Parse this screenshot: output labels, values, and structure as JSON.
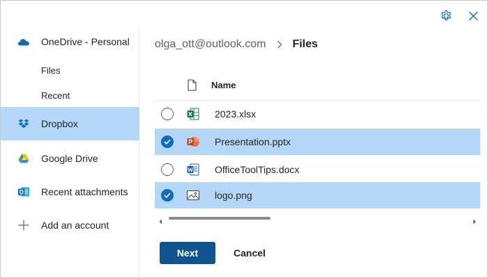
{
  "header": {
    "settings_icon": "gear-icon",
    "close_icon": "close-icon"
  },
  "sidebar": {
    "accounts": [
      {
        "label": "OneDrive - Personal",
        "icon": "onedrive-icon",
        "children": [
          {
            "label": "Files"
          },
          {
            "label": "Recent"
          }
        ]
      },
      {
        "label": "Dropbox",
        "icon": "dropbox-icon",
        "selected": true
      },
      {
        "label": "Google Drive",
        "icon": "google-drive-icon"
      },
      {
        "label": "Recent attachments",
        "icon": "outlook-icon"
      },
      {
        "label": "Add an account",
        "icon": "plus-icon"
      }
    ]
  },
  "breadcrumb": {
    "root": "olga_ott@outlook.com",
    "current": "Files"
  },
  "file_list": {
    "column_name": "Name",
    "files": [
      {
        "name": "2023.xlsx",
        "type": "excel",
        "selected": false
      },
      {
        "name": "Presentation.pptx",
        "type": "powerpoint",
        "selected": true
      },
      {
        "name": "OfficeToolTips.docx",
        "type": "word",
        "selected": false
      },
      {
        "name": "logo.png",
        "type": "image",
        "selected": true
      }
    ]
  },
  "actions": {
    "next": "Next",
    "cancel": "Cancel"
  },
  "colors": {
    "selection": "#b3d6f9",
    "primary_button": "#0f548c",
    "checkbox_selected": "#0f6cbd"
  }
}
